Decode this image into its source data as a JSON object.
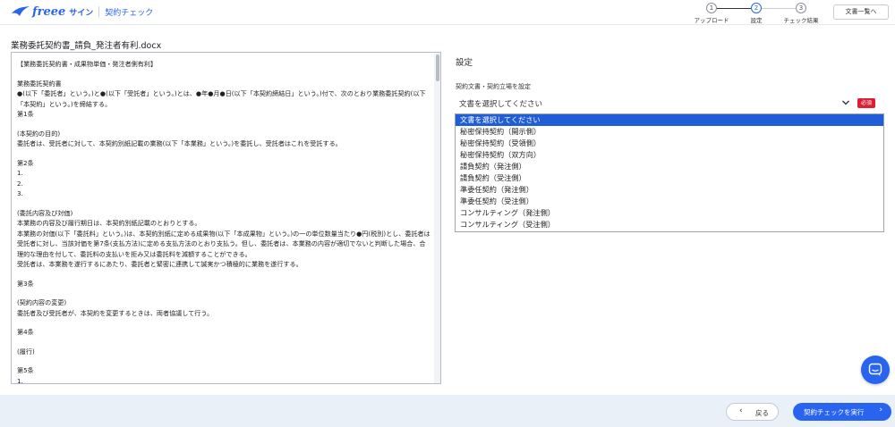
{
  "header": {
    "brand": "freee",
    "brand_sub": "サイン",
    "app_name": "契約チェック",
    "doc_list_button": "文書一覧へ",
    "steps": [
      {
        "number": "1",
        "label": "アップロード"
      },
      {
        "number": "2",
        "label": "設定"
      },
      {
        "number": "3",
        "label": "チェック結果"
      }
    ]
  },
  "document": {
    "filename": "業務委託契約書_請負_発注者有利.docx",
    "paragraphs": [
      "【業務委託契約書・成果物単価・発注者側有利】",
      "",
      "業務委託契約書",
      "●(以下「委託者」という。)と●(以下「受託者」という。)とは、●年●月●日(以下「本契約締結日」という。)付で、次のとおり業務委託契約(以下「本契約」という。)を締結する。",
      "第1条",
      "",
      "(本契約の目的)",
      "委託者は、受託者に対して、本契約別紙記載の業務(以下「本業務」という。)を委託し、受託者はこれを受託する。",
      "",
      "第2条",
      "1.",
      "2.",
      "3.",
      "",
      "(委託内容及び対価)",
      "本業務の内容及び履行期日は、本契約別紙記載のとおりとする。",
      "本業務の対価(以下「委託料」という。)は、本契約別紙に定める成果物(以下「本成果物」という。)の一の単位数量当たり●円(税別)とし、委託者は受託者に対し、当該対価を第7条(支払方法)に定める支払方法のとおり支払う。但し、委託者は、本業務の内容が適切でないと判断した場合、合理的な理由を付して、委託料の支払いを拒み又は委託料を減額することができる。",
      "受託者は、本業務を遂行するにあたり、委託者と緊密に連携して誠実かつ積極的に業務を遂行する。",
      "",
      "第3条",
      "",
      "(契約内容の変更)",
      "委託者及び受託者が、本契約を変更するときは、両者協議して行う。",
      "",
      "第4条",
      "",
      "(履行)",
      "",
      "第5条",
      "1."
    ]
  },
  "settings": {
    "title": "設定",
    "field_label": "契約文書・契約立場を設定",
    "selected_value": "文書を選択してください",
    "required_badge": "必須",
    "options": [
      "文書を選択してください",
      "秘密保持契約（開示側）",
      "秘密保持契約（受領側）",
      "秘密保持契約（双方向）",
      "請負契約（発注側）",
      "請負契約（受注側）",
      "準委任契約（発注側）",
      "準委任契約（受注側）",
      "コンサルティング（発注側）",
      "コンサルティング（受注側）"
    ]
  },
  "footer": {
    "back_label": "戻る",
    "run_label": "契約チェックを実行"
  },
  "colors": {
    "brand_blue": "#2864f0",
    "selected_option": "#1f5ed6",
    "required_red": "#dc1e32",
    "footer_bg": "#eaf0f8"
  }
}
